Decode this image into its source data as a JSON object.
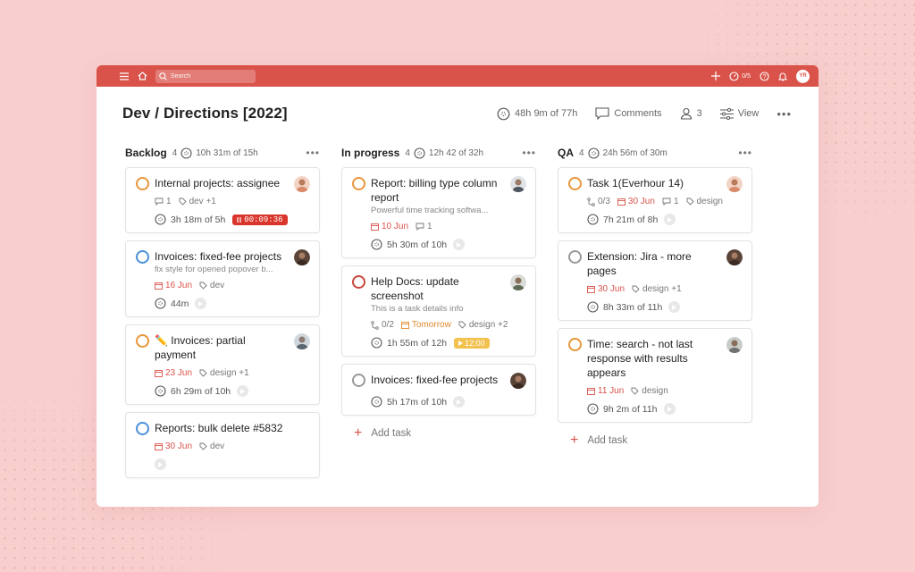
{
  "search": {
    "placeholder": "Search"
  },
  "topbar": {
    "counter": "0/5",
    "user_initials": "YR"
  },
  "page": {
    "title": "Dev / Directions [2022]",
    "time_summary": "48h 9m of 77h",
    "comments_label": "Comments",
    "members_count": "3",
    "view_label": "View"
  },
  "colors": {
    "accent": "#d9534a",
    "orange": "#e8963b",
    "blue": "#4a90d9",
    "gray": "#999999"
  },
  "columns": [
    {
      "name": "Backlog",
      "count": "4",
      "time": "10h 31m of 15h",
      "cards": [
        {
          "title": "Internal projects: assignee",
          "comments": "1",
          "tags": "dev +1",
          "time": "3h 18m of 5h",
          "timer": "00:09:36"
        },
        {
          "title": "Invoices: fixed-fee projects",
          "desc": "fix style for opened popover b...",
          "date": "16 Jun",
          "tags": "dev",
          "time": "44m"
        },
        {
          "title": "✏️ Invoices: partial payment",
          "date": "23 Jun",
          "tags": "design +1",
          "time": "6h 29m of 10h"
        },
        {
          "title": "Reports: bulk delete #5832",
          "date": "30 Jun",
          "tags": "dev"
        }
      ]
    },
    {
      "name": "In progress",
      "count": "4",
      "time": "12h 42 of 32h",
      "cards": [
        {
          "title": "Report: billing type column report",
          "desc": "Powerful time tracking softwa...",
          "date": "10 Jun",
          "comments": "1",
          "time": "5h 30m of 10h"
        },
        {
          "title": "Help Docs: update screenshot",
          "desc": "This is a task details info",
          "subtasks": "0/2",
          "date": "Tomorrow",
          "tags": "design +2",
          "time": "1h 55m of 12h",
          "schedule": "12:00"
        },
        {
          "title": "Invoices: fixed-fee projects",
          "time": "5h 17m of 10h"
        }
      ],
      "add_task": "Add task"
    },
    {
      "name": "QA",
      "count": "4",
      "time": "24h 56m of 30m",
      "cards": [
        {
          "title": "Task 1(Everhour 14)",
          "subtasks": "0/3",
          "date": "30 Jun",
          "comments": "1",
          "tags": "design",
          "time": "7h 21m of 8h"
        },
        {
          "title": "Extension: Jira - more pages",
          "date": "30 Jun",
          "tags": "design +1",
          "time": "8h 33m of 11h"
        },
        {
          "title": "Time: search - not last response with results appears",
          "date": "11 Jun",
          "tags": "design",
          "time": "9h 2m of 11h"
        }
      ],
      "add_task": "Add task"
    }
  ]
}
